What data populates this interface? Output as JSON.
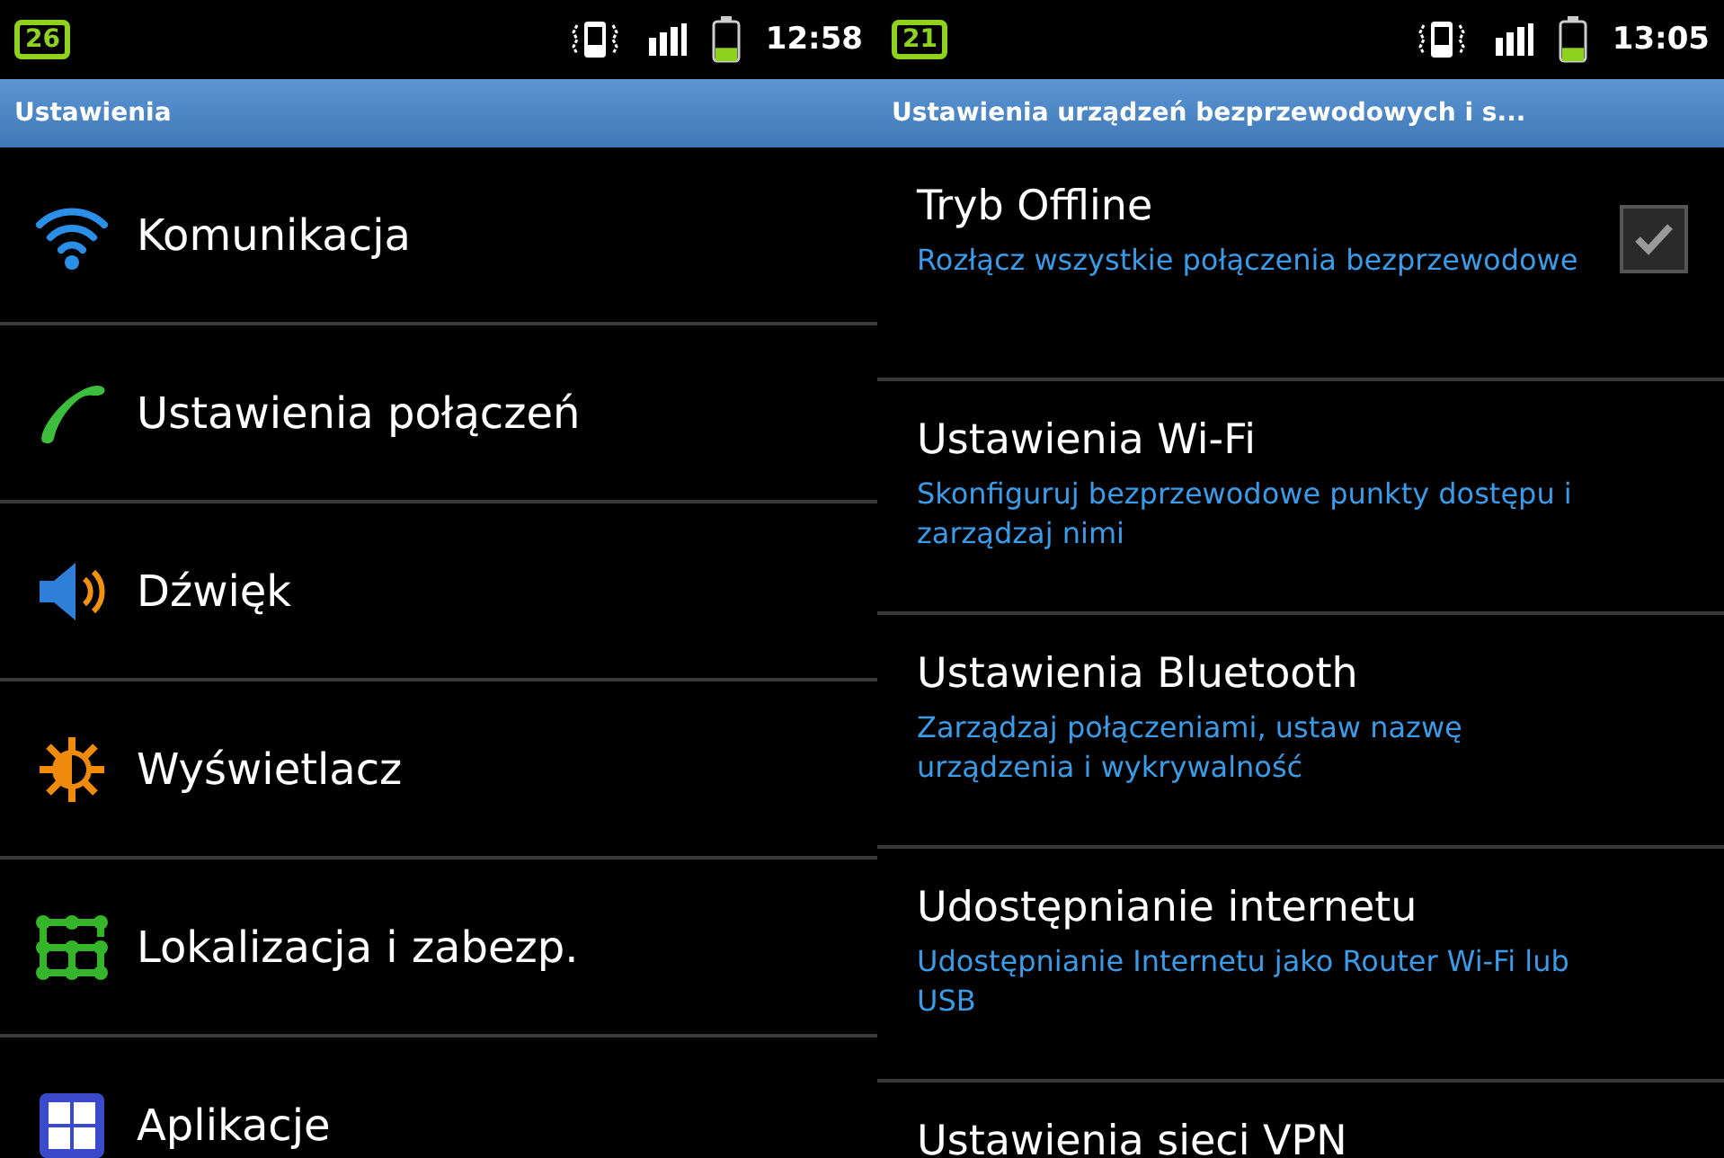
{
  "screens": [
    {
      "status_bar": {
        "badge": "26",
        "time": "12:58",
        "battery": {
          "level": 0.35
        }
      },
      "title": "Ustawienia",
      "kind": "menu",
      "items": [
        {
          "label": "Komunikacja",
          "kind": "wifi"
        },
        {
          "label": "Ustawienia połączeń",
          "kind": "phone"
        },
        {
          "label": "Dźwięk",
          "kind": "speaker"
        },
        {
          "label": "Wyświetlacz",
          "kind": "sun"
        },
        {
          "label": "Lokalizacja i zabezp.",
          "kind": "grid"
        },
        {
          "label": "Aplikacje",
          "kind": "apps"
        }
      ]
    },
    {
      "status_bar": {
        "badge": "21",
        "time": "13:05",
        "battery": {
          "level": 0.35
        }
      },
      "title": "Ustawienia urządzeń bezprzewodowych i s...",
      "kind": "prefs",
      "items": [
        {
          "label": "Tryb Offline",
          "summary": "Rozłącz wszystkie połączenia bezprzewodowe",
          "kind": "checkbox",
          "checked": true
        },
        {
          "label": "Ustawienia Wi-Fi",
          "summary": "Skonfiguruj bezprzewodowe punkty dostępu i zarządzaj nimi",
          "kind": "plain"
        },
        {
          "label": "Ustawienia Bluetooth",
          "summary": "Zarządzaj połączeniami, ustaw nazwę urządzenia i wykrywalność",
          "kind": "plain"
        },
        {
          "label": "Udostępnianie internetu",
          "summary": "Udostępnianie Internetu jako Router Wi-Fi lub USB",
          "kind": "plain"
        },
        {
          "label": "Ustawienia sieci VPN",
          "kind": "plain"
        }
      ]
    }
  ]
}
